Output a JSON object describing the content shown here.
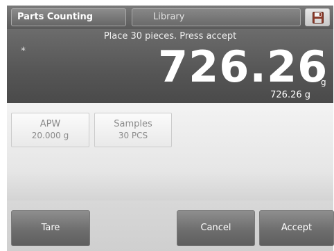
{
  "header": {
    "mode_tab": "Parts Counting",
    "library_tab": "Library",
    "save_icon": "floppy-disk-icon"
  },
  "display": {
    "instruction": "Place 30 pieces.  Press accept",
    "stability_mark": "*",
    "main_value": "726.26",
    "main_unit": "g",
    "secondary": "726.26 g"
  },
  "params": [
    {
      "label": "APW",
      "value": "20.000 g"
    },
    {
      "label": "Samples",
      "value": "30 PCS"
    }
  ],
  "actions": {
    "tare": "Tare",
    "cancel": "Cancel",
    "accept": "Accept"
  }
}
